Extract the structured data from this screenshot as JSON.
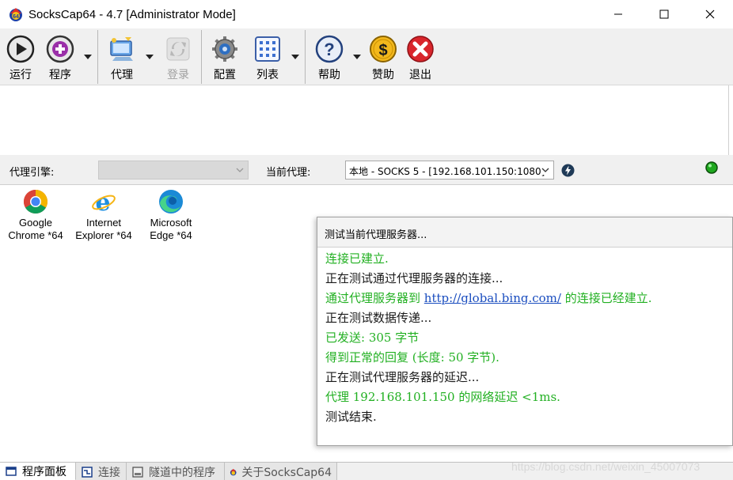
{
  "window": {
    "title": "SocksCap64 - 4.7 [Administrator Mode]",
    "app_icon": "sockscap64-logo-icon"
  },
  "toolbar": {
    "buttons": [
      {
        "label": "运行",
        "icon": "play-icon",
        "enabled": true
      },
      {
        "label": "程序",
        "icon": "add-program-icon",
        "enabled": true
      },
      {
        "label": "代理",
        "icon": "proxy-icon",
        "enabled": true
      },
      {
        "label": "登录",
        "icon": "login-icon",
        "enabled": false
      },
      {
        "label": "配置",
        "icon": "gear-icon",
        "enabled": true
      },
      {
        "label": "列表",
        "icon": "list-grid-icon",
        "enabled": true
      },
      {
        "label": "帮助",
        "icon": "help-icon",
        "enabled": true
      },
      {
        "label": "赞助",
        "icon": "dollar-coin-icon",
        "enabled": true
      },
      {
        "label": "退出",
        "icon": "exit-icon",
        "enabled": true
      }
    ]
  },
  "proxy_bar": {
    "engine_label": "代理引擎:",
    "engine_value": "",
    "current_label": "当前代理:",
    "current_value": "本地 - SOCKS 5 - [192.168.101.150:1080]"
  },
  "programs": [
    {
      "name_line1": "Google",
      "name_line2": "Chrome *64",
      "icon": "chrome-icon"
    },
    {
      "name_line1": "Internet",
      "name_line2": "Explorer *64",
      "icon": "internet-explorer-icon"
    },
    {
      "name_line1": "Microsoft",
      "name_line2": "Edge *64",
      "icon": "edge-icon"
    }
  ],
  "test_dialog": {
    "title": "测试当前代理服务器...",
    "lines": [
      {
        "text": "连接已建立.",
        "status": "ok"
      },
      {
        "text": "正在测试通过代理服务器的连接...",
        "status": "info"
      },
      {
        "text_before": "通过代理服务器到 ",
        "link": "http://global.bing.com/",
        "text_after": " 的连接已经建立.",
        "status": "ok"
      },
      {
        "text": "正在测试数据传递...",
        "status": "info"
      },
      {
        "text": "已发送: 305 字节",
        "status": "ok"
      },
      {
        "text": "得到正常的回复 (长度: 50 字节).",
        "status": "ok"
      },
      {
        "text": "正在测试代理服务器的延迟...",
        "status": "info"
      },
      {
        "text": "代理 192.168.101.150 的网络延迟 <1ms.",
        "status": "ok"
      },
      {
        "text": "测试结束.",
        "status": "info"
      }
    ]
  },
  "tabs": [
    {
      "label": "程序面板",
      "icon": "panel-icon",
      "active": true
    },
    {
      "label": "连接",
      "icon": "connections-icon",
      "active": false
    },
    {
      "label": "隧道中的程序",
      "icon": "tunnel-programs-icon",
      "active": false
    },
    {
      "label": "关于SocksCap64",
      "icon": "sockscap64-logo-icon",
      "active": false
    }
  ],
  "watermark": "https://blog.csdn.net/weixin_45007073",
  "colors": {
    "ok_text": "#22b022",
    "link": "#1a4dbf",
    "status_connected": "#1fa81f"
  }
}
